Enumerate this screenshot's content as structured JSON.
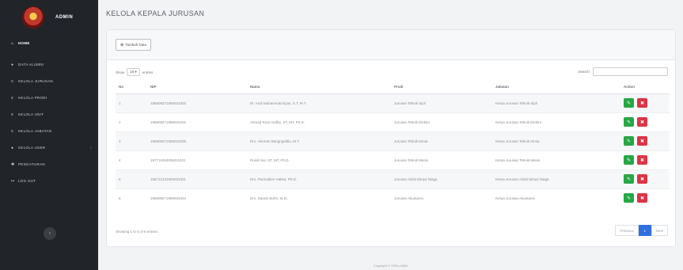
{
  "sidebar": {
    "brand": "ADMIN",
    "items": [
      {
        "label": "HOME",
        "icon": "home-icon"
      },
      {
        "label": "DATA ALUMNI",
        "icon": "users-icon"
      },
      {
        "label": "KELOLA JURUSAN",
        "icon": "list-icon"
      },
      {
        "label": "KELOLA PRODI",
        "icon": "list-icon"
      },
      {
        "label": "KELOLA UNIT",
        "icon": "list-icon"
      },
      {
        "label": "KELOLA JABATAN",
        "icon": "list-icon"
      },
      {
        "label": "KELOLA USER",
        "icon": "user-icon"
      },
      {
        "label": "PENGATURAN",
        "icon": "gear-icon"
      },
      {
        "label": "LOG OUT",
        "icon": "logout-icon"
      }
    ]
  },
  "page": {
    "title": "KELOLA KEPALA JURUSAN",
    "add_button": "Tambah Data",
    "show_label": "Show",
    "show_value": "10",
    "entries_label": "entries",
    "search_label": "Search:"
  },
  "table": {
    "headers": [
      "No",
      "NIP",
      "Nama",
      "Prodi",
      "Jabatan",
      "Action"
    ],
    "rows": [
      {
        "no": "1",
        "nip": "196808271990031003",
        "nama": "Dr. Andi Muhammad Ilyas, S.T, M.T.",
        "prodi": "Jurusan Teknik Sipil",
        "jabatan": "Ketua Jurusan Teknik Sipil"
      },
      {
        "no": "2",
        "nip": "196808271990031002",
        "nama": "Ahmad Rizal Gaffar, ST, MT, Ph.D.",
        "prodi": "Jurusan Teknik Elektro",
        "jabatan": "Ketua Jurusan Teknik Elektro"
      },
      {
        "no": "3",
        "nip": "196808271990031005",
        "nama": "Drs. Herman Bangngalibu, M.T.",
        "prodi": "Jurusan Teknik Kimia",
        "jabatan": "Ketua Jurusan Teknik Kimia"
      },
      {
        "no": "4",
        "nip": "197711062005011001",
        "nama": "Rusdi Nur, ST, MT, Ph.D.",
        "prodi": "Jurusan Teknik Mesin",
        "jabatan": "Ketua Jurusan Teknik Mesin"
      },
      {
        "no": "5",
        "nip": "196712131993031001",
        "nama": "Drs. Parmadien Hakka, Ph.D.",
        "prodi": "Jurusan Administrasi Niaga",
        "jabatan": "Ketua Jurusan Administrasi Niaga"
      },
      {
        "no": "6",
        "nip": "196808271990031004",
        "nama": "Drs. Darwis Bohri, M.Si.",
        "prodi": "Jurusan Akuntansi",
        "jabatan": "Ketua Jurusan Akuntansi"
      }
    ]
  },
  "footer_info": {
    "showing": "Showing 1 to 6 of 6 entries",
    "previous": "Previous",
    "page": "1",
    "next": "Next",
    "copyright": "Copyright © SIPALUMNI"
  },
  "colors": {
    "sidebar": "#212529",
    "edit": "#28a745",
    "delete": "#dc3545",
    "page_active": "#2f6fe0"
  }
}
